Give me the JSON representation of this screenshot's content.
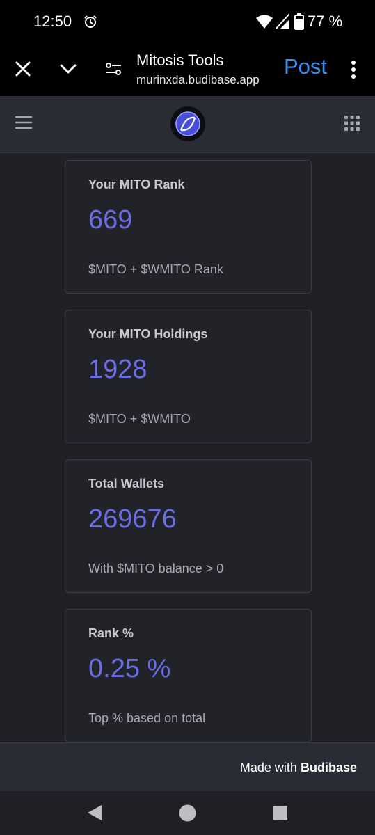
{
  "status_bar": {
    "time": "12:50",
    "battery": "77 %",
    "icons": [
      "alarm-icon",
      "wifi-icon",
      "signal-icon",
      "battery-icon"
    ]
  },
  "browser": {
    "title": "Mitosis Tools",
    "url": "murinxda.budibase.app",
    "action_label": "Post",
    "icons": [
      "close-icon",
      "chevron-down-icon",
      "page-settings-icon",
      "more-vert-icon"
    ],
    "accent_color": "#3b8ff2"
  },
  "app_header": {
    "icons": [
      "menu-icon",
      "mitosis-logo",
      "apps-grid-icon"
    ],
    "background": "#2a2c33"
  },
  "cards": [
    {
      "title": "Your MITO Rank",
      "value": "669",
      "subtitle": "$MITO + $WMITO Rank"
    },
    {
      "title": "Your MITO Holdings",
      "value": "1928",
      "subtitle": "$MITO + $WMITO"
    },
    {
      "title": "Total Wallets",
      "value": "269676",
      "subtitle": "With $MITO balance > 0"
    },
    {
      "title": "Rank %",
      "value": "0.25 %",
      "subtitle": "Top % based on total"
    }
  ],
  "value_color": "#6a6ee6",
  "footer": {
    "prefix": "Made with",
    "brand": "Budibase"
  },
  "nav_bar": {
    "icons": [
      "back-icon",
      "home-icon",
      "recents-icon"
    ]
  }
}
